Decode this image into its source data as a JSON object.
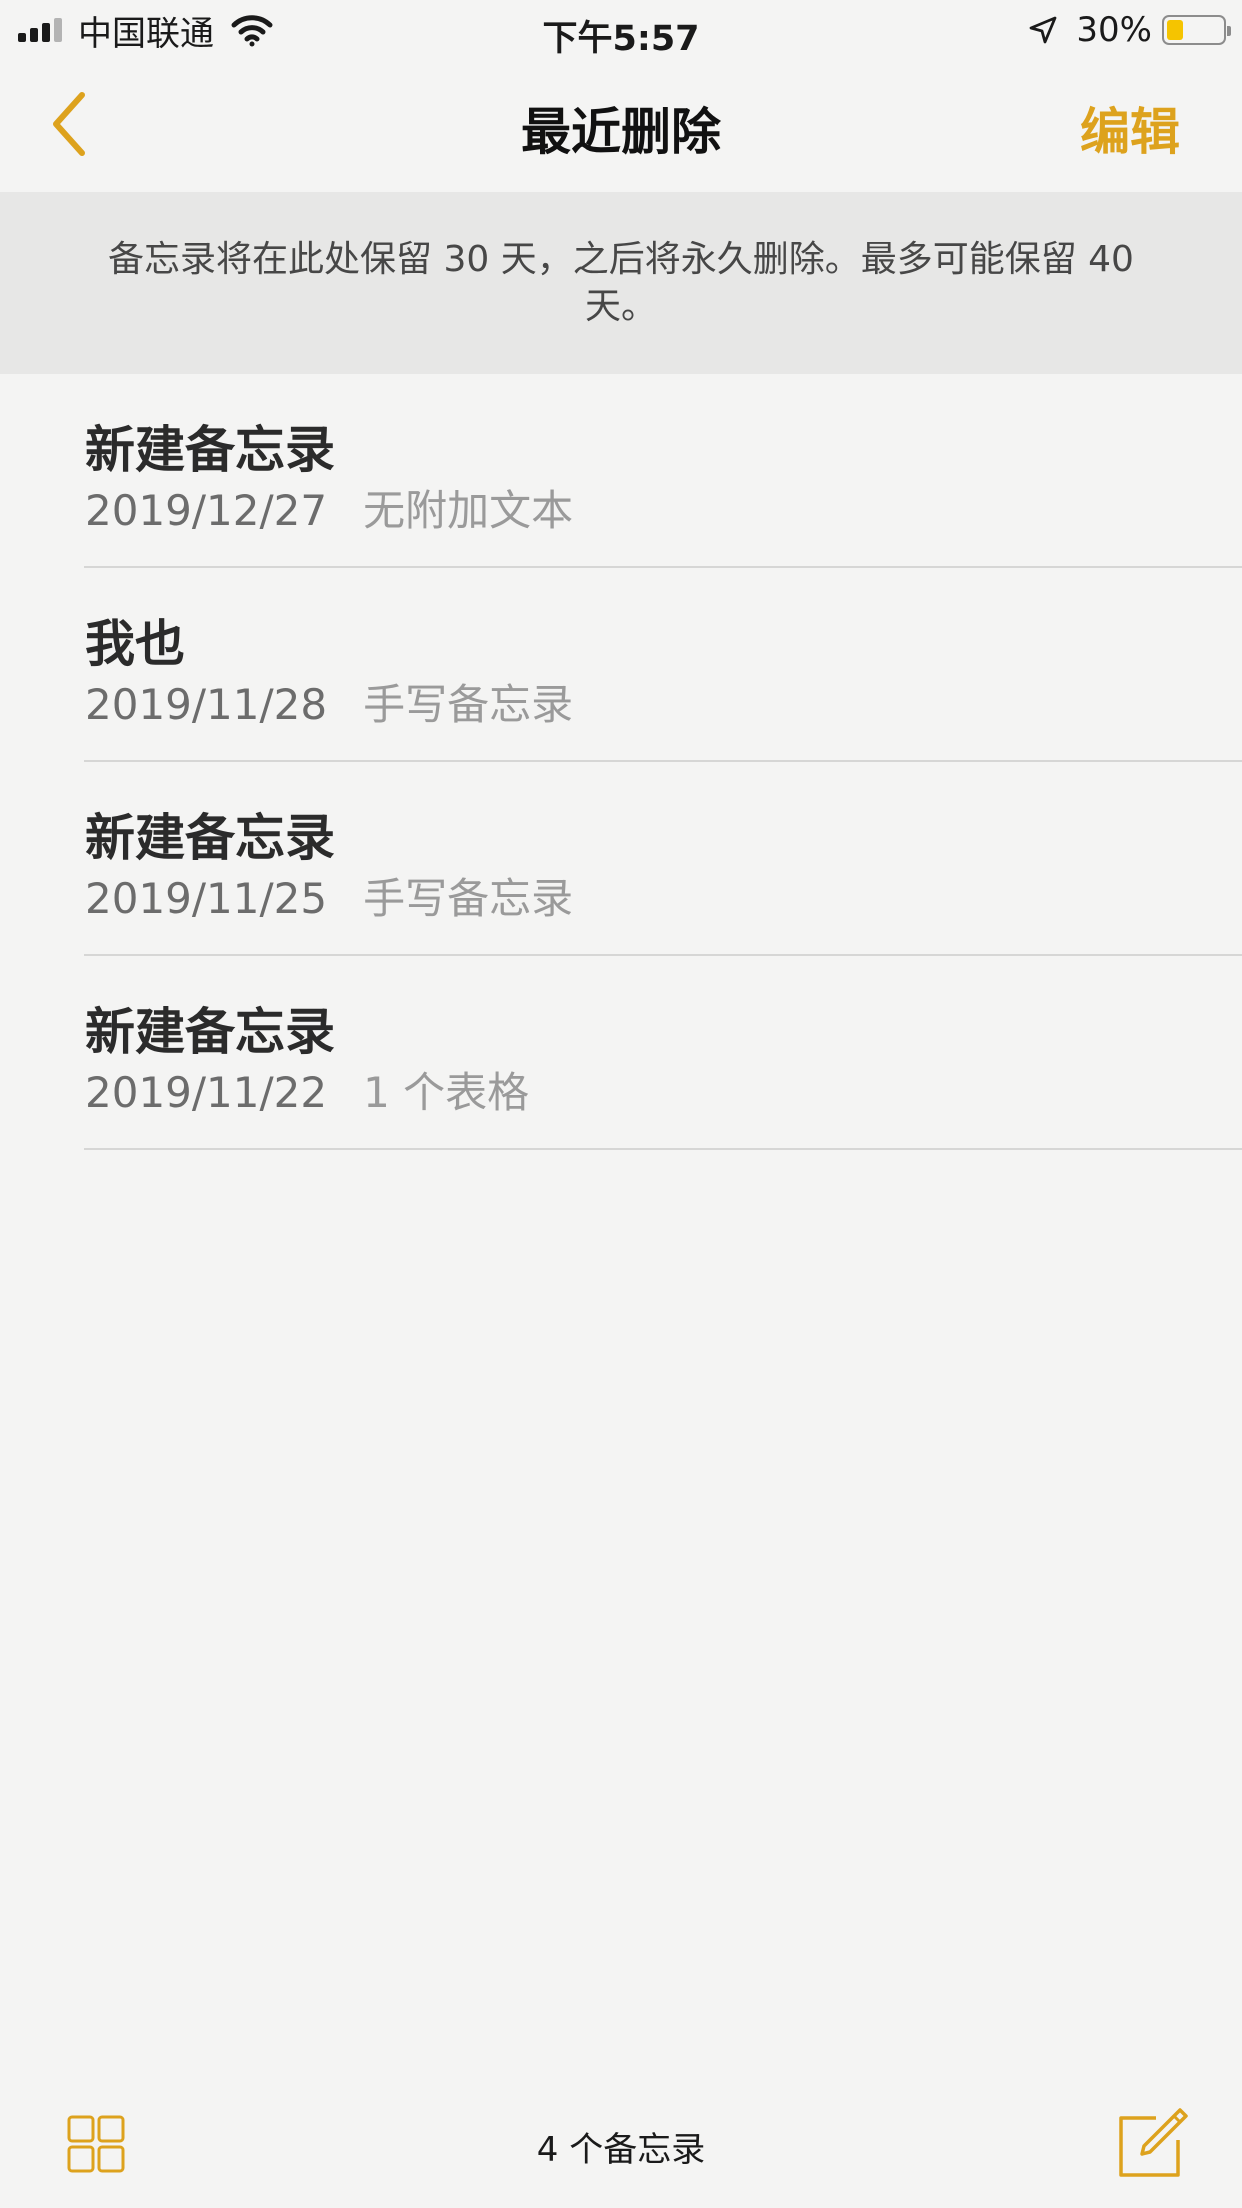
{
  "status_bar": {
    "carrier": "中国联通",
    "time": "下午5:57",
    "battery_percent": "30%",
    "battery_level": 0.3,
    "signal_bars_filled": 3,
    "signal_bars_total": 4,
    "icons": [
      "wifi-icon",
      "location-arrow-icon",
      "battery-icon"
    ]
  },
  "nav": {
    "title": "最近删除",
    "edit_label": "编辑",
    "back_icon": "chevron-left-icon"
  },
  "banner": {
    "text": "备忘录将在此处保留 30 天，之后将永久删除。最多可能保留 40 天。"
  },
  "notes": [
    {
      "title": "新建备忘录",
      "date": "2019/12/27",
      "description": "无附加文本"
    },
    {
      "title": "我也",
      "date": "2019/11/28",
      "description": "手写备忘录"
    },
    {
      "title": "新建备忘录",
      "date": "2019/11/25",
      "description": "手写备忘录"
    },
    {
      "title": "新建备忘录",
      "date": "2019/11/22",
      "description": "1 个表格"
    }
  ],
  "toolbar": {
    "count_label": "4 个备忘录",
    "gallery_icon": "grid-view-icon",
    "compose_icon": "compose-icon"
  },
  "colors": {
    "accent": "#dda21d",
    "background": "#f4f4f3",
    "banner_background": "#e7e7e6",
    "battery_fill": "#f5c400"
  }
}
